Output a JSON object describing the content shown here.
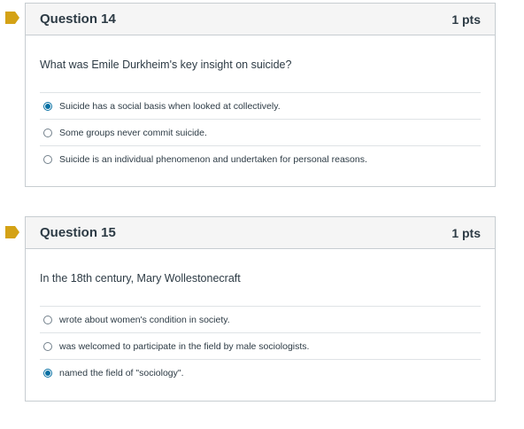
{
  "colors": {
    "flag": "#d4a216",
    "radio_selected": "#0770a3",
    "border": "#c7cdd1",
    "header_bg": "#f5f5f5"
  },
  "questions": [
    {
      "title": "Question 14",
      "points": "1 pts",
      "text": "What was Emile Durkheim's key insight on suicide?",
      "answers": [
        {
          "label": "Suicide has a social basis when looked at collectively.",
          "selected": true
        },
        {
          "label": "Some groups never commit suicide.",
          "selected": false
        },
        {
          "label": "Suicide is an individual phenomenon and undertaken for personal reasons.",
          "selected": false
        }
      ]
    },
    {
      "title": "Question 15",
      "points": "1 pts",
      "text": "In the 18th century, Mary Wollestonecraft",
      "answers": [
        {
          "label": "wrote about women's condition in society.",
          "selected": false
        },
        {
          "label": "was welcomed to participate in the field by male sociologists.",
          "selected": false
        },
        {
          "label": "named the field of \"sociology\".",
          "selected": true
        }
      ]
    }
  ]
}
